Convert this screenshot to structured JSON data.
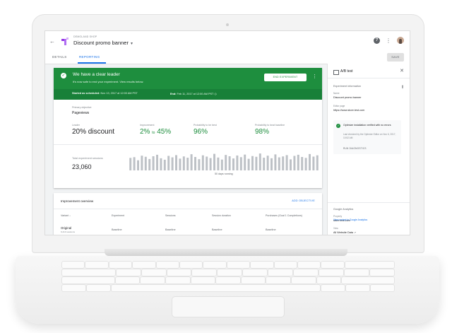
{
  "app": {
    "breadcrumb": "DEMOLAND SHOP",
    "title": "Discount promo banner"
  },
  "tabs": [
    {
      "label": "DETAILS"
    },
    {
      "label": "REPORTING"
    }
  ],
  "save_label": "SAVE",
  "banner": {
    "title": "We have a clear leader",
    "subtitle": "It's now safe to end your experiment. View results below.",
    "button": "END EXPERIMENT",
    "started_label": "Started as scheduled:",
    "started_value": "Nov 13, 2017 at 12:00 AM PST",
    "ended_label": "End:",
    "ended_value": "Feb 11, 2017 at 12:00 AM PST"
  },
  "objective": {
    "label": "Primary objective",
    "value": "Pageviews"
  },
  "stats": {
    "leader_label": "Leader",
    "leader_value": "20% discount",
    "improvement_label": "Improvement",
    "improvement_low": "2%",
    "improvement_to": "to",
    "improvement_high": "45%",
    "prob_label": "Probability to be best",
    "prob_value": "96%",
    "beat_label": "Probability to beat baseline",
    "beat_value": "98%"
  },
  "sessions": {
    "label": "Total experiment sessions",
    "value": "23,060",
    "running_label": "50 days running"
  },
  "chart_data": {
    "type": "bar",
    "title": "",
    "xlabel": "50 days running",
    "ylabel": "",
    "values": [
      68,
      72,
      55,
      80,
      74,
      62,
      77,
      85,
      66,
      58,
      79,
      71,
      83,
      64,
      76,
      69,
      88,
      73,
      61,
      82,
      75,
      67,
      90,
      70,
      59,
      84,
      77,
      65,
      81,
      72,
      86,
      63,
      78,
      74,
      92,
      69,
      80,
      66,
      87,
      71,
      76,
      83,
      60,
      79,
      85,
      73,
      68,
      89,
      75,
      82
    ]
  },
  "overview": {
    "title": "Improvement overview",
    "add_label": "ADD OBJECTIVE",
    "columns": [
      "Variant",
      "Experiment",
      "Sessions",
      "Session duration",
      "Purchases (Goal 1 Completions)"
    ],
    "row": {
      "name": "Original",
      "sub": "9,410 sessions",
      "cells": [
        "Baseline",
        "Baseline",
        "Baseline",
        "Baseline"
      ]
    }
  },
  "panel": {
    "title": "A/B test",
    "section": "Experiment information",
    "name_label": "Name",
    "name_value": "Discount promo banner",
    "editor_label": "Editor page",
    "editor_value": "https://www.store.test.com",
    "status_title": "Optimize installation verified with no errors",
    "status_sub": "Last checked by the Optimize Editor on Nov 6, 2017, 10:52 AM",
    "status_button": "RUN DIAGNOSTICS",
    "ga_section": "Google Analytics",
    "property_label": "Property",
    "property_value": "store.test.com",
    "view_label": "View",
    "view_value": "All Website Data",
    "link": "View variant in Google Analytics"
  },
  "colors": {
    "accent": "#1a73e8",
    "success": "#1e8e3e",
    "success_dark": "#188038"
  }
}
